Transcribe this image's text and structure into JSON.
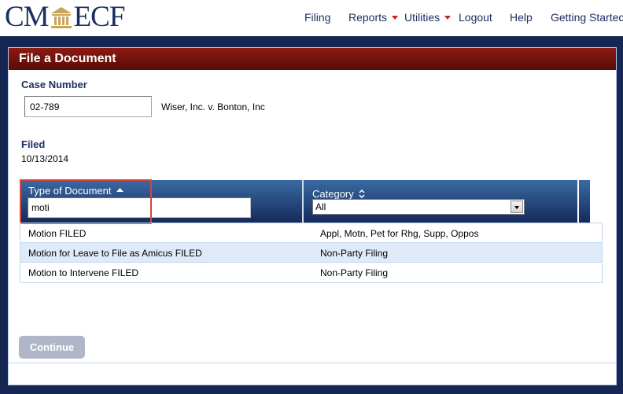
{
  "logo": {
    "left_text": "CM",
    "right_text": "ECF",
    "icon": "courthouse-icon"
  },
  "nav": [
    {
      "label": "Filing",
      "has_menu": false
    },
    {
      "label": "Reports",
      "has_menu": true
    },
    {
      "label": "Utilities",
      "has_menu": true
    },
    {
      "label": "Logout",
      "has_menu": false
    },
    {
      "label": "Help",
      "has_menu": false
    },
    {
      "label": "Getting Started",
      "has_menu": false
    }
  ],
  "panel": {
    "title": "File a Document",
    "case_number_label": "Case Number",
    "case_number_value": "02-789",
    "case_name": "Wiser, Inc. v. Bonton, Inc",
    "filed_label": "Filed",
    "filed_date": "10/13/2014"
  },
  "grid": {
    "columns": [
      {
        "title": "Type of Document",
        "sort": "ascending",
        "sort_icon": "sort-up-icon",
        "filter_value": "moti"
      },
      {
        "title": "Category",
        "sort": "none",
        "sort_icon": "sort-both-icon",
        "filter_value": "All"
      }
    ],
    "rows": [
      {
        "type": "Motion FILED",
        "category": "Appl, Motn, Pet for Rhg, Supp, Oppos"
      },
      {
        "type": "Motion for Leave to File as Amicus FILED",
        "category": "Non-Party Filing"
      },
      {
        "type": "Motion to Intervene FILED",
        "category": "Non-Party Filing"
      }
    ]
  },
  "continue_label": "Continue",
  "colors": {
    "brand_navy": "#1b2f62",
    "frame": "#172753",
    "title_bar": "#7a150e",
    "header_blue": "#2c5590",
    "highlight": "#d9443f",
    "menu_caret": "#cc1f1f",
    "button_disabled": "#b0b6c7"
  }
}
